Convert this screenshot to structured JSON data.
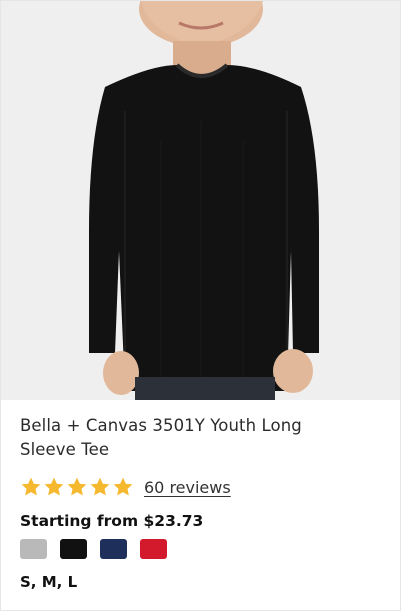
{
  "product": {
    "title": "Bella + Canvas 3501Y Youth Long Sleeve Tee",
    "rating": 5,
    "reviews_label": "60 reviews",
    "price_label": "Starting from $23.73",
    "sizes_label": "S, M, L",
    "image_icon": "product-photo-black-long-sleeve-tee",
    "star_color": "#f5b82e",
    "swatches": [
      {
        "name": "Athletic Heather",
        "color": "#b9b9b9"
      },
      {
        "name": "Black",
        "color": "#111111"
      },
      {
        "name": "Navy",
        "color": "#1f2f5c"
      },
      {
        "name": "Red",
        "color": "#d21a2c"
      }
    ]
  }
}
